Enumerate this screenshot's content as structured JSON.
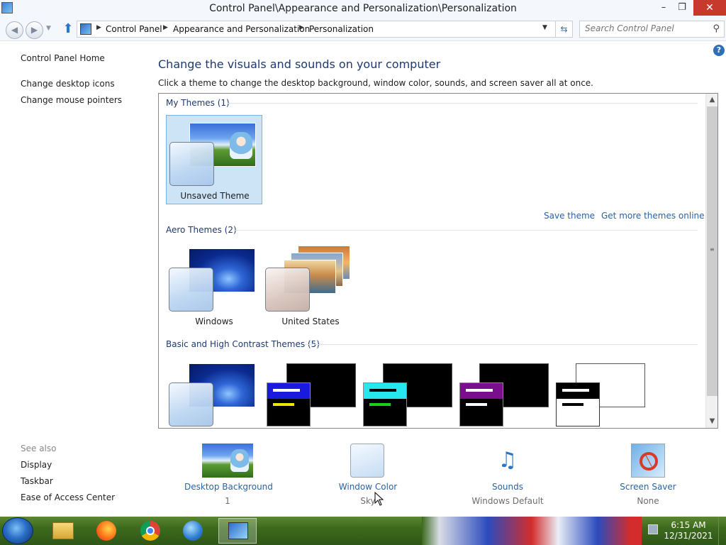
{
  "window": {
    "title": "Control Panel\\Appearance and Personalization\\Personalization",
    "minimize": "–",
    "restore": "❐",
    "close": "✕"
  },
  "address": {
    "crumbs": [
      "Control Panel",
      "Appearance and Personalization",
      "Personalization"
    ],
    "search_placeholder": "Search Control Panel"
  },
  "left_nav": {
    "home": "Control Panel Home",
    "links": [
      "Change desktop icons",
      "Change mouse pointers"
    ],
    "see_also_label": "See also",
    "see_also": [
      "Display",
      "Taskbar",
      "Ease of Access Center"
    ]
  },
  "main": {
    "title": "Change the visuals and sounds on your computer",
    "description": "Click a theme to change the desktop background, window color, sounds, and screen saver all at once.",
    "help": "?",
    "groups": {
      "my": {
        "header": "My Themes (1)",
        "themes": [
          "Unsaved Theme"
        ]
      },
      "aero": {
        "header": "Aero Themes (2)",
        "themes": [
          "Windows",
          "United States"
        ]
      },
      "basic": {
        "header": "Basic and High Contrast Themes (5)"
      }
    },
    "save_theme": "Save theme",
    "more_themes": "Get more themes online"
  },
  "tiles": [
    {
      "label": "Desktop Background",
      "value": "1"
    },
    {
      "label": "Window Color",
      "value": "Sky"
    },
    {
      "label": "Sounds",
      "value": "Windows Default"
    },
    {
      "label": "Screen Saver",
      "value": "None"
    }
  ],
  "taskbar": {
    "time": "6:15 AM",
    "date": "12/31/2021"
  }
}
